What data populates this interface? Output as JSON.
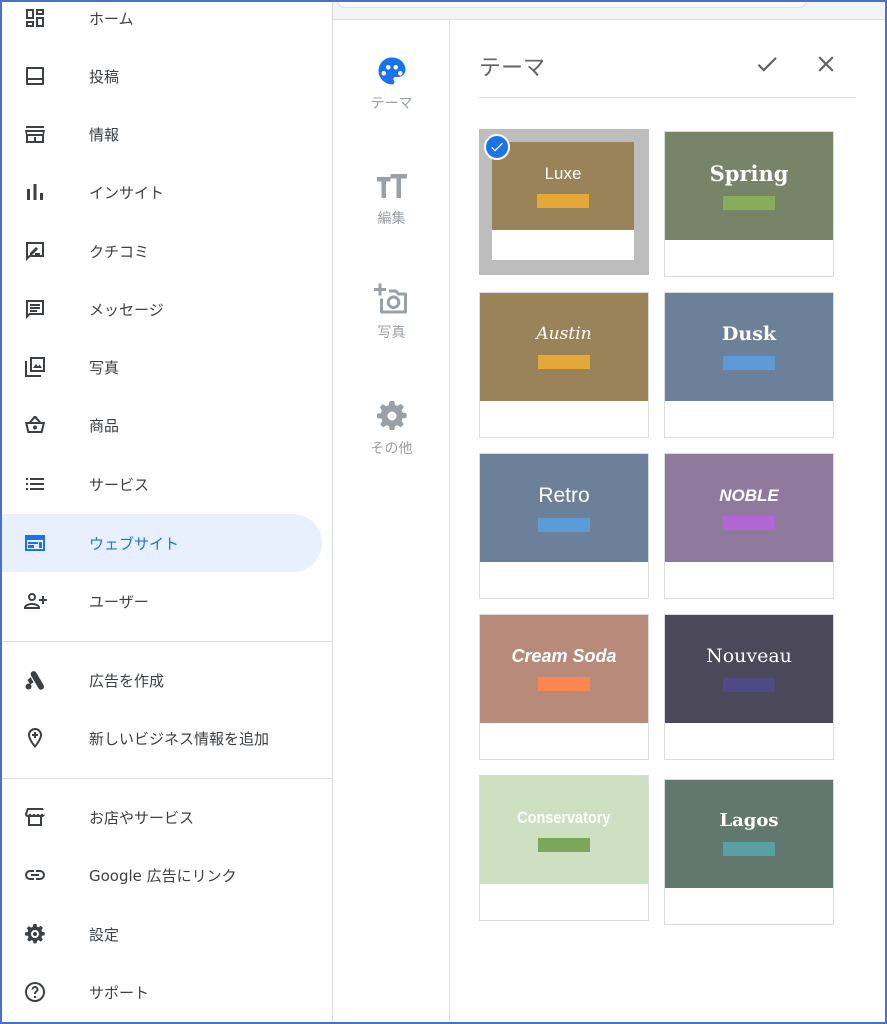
{
  "nav": {
    "items": [
      {
        "label": "ホーム",
        "icon": "dashboard-icon"
      },
      {
        "label": "投稿",
        "icon": "post-icon"
      },
      {
        "label": "情報",
        "icon": "storefront-icon"
      },
      {
        "label": "インサイト",
        "icon": "bar-chart-icon"
      },
      {
        "label": "クチコミ",
        "icon": "rate-review-icon"
      },
      {
        "label": "メッセージ",
        "icon": "message-icon"
      },
      {
        "label": "写真",
        "icon": "photo-library-icon"
      },
      {
        "label": "商品",
        "icon": "shopping-basket-icon"
      },
      {
        "label": "サービス",
        "icon": "list-icon"
      },
      {
        "label": "ウェブサイト",
        "icon": "web-icon",
        "active": true
      },
      {
        "label": "ユーザー",
        "icon": "person-add-icon"
      }
    ],
    "secondary": [
      {
        "label": "広告を作成",
        "icon": "google-ads-icon"
      },
      {
        "label": "新しいビジネス情報を追加",
        "icon": "add-location-icon"
      }
    ],
    "footer": [
      {
        "label": "お店やサービス",
        "icon": "store-icon"
      },
      {
        "label": "Google 広告にリンク",
        "icon": "link-icon"
      },
      {
        "label": "設定",
        "icon": "settings-icon"
      },
      {
        "label": "サポート",
        "icon": "help-icon"
      }
    ]
  },
  "tools": [
    {
      "label": "テーマ",
      "icon": "palette-icon",
      "active": true
    },
    {
      "label": "編集",
      "icon": "text-fields-icon"
    },
    {
      "label": "写真",
      "icon": "add-photo-icon"
    },
    {
      "label": "その他",
      "icon": "settings-icon"
    }
  ],
  "panel": {
    "title": "テーマ",
    "confirm_icon": "check-icon",
    "close_icon": "close-icon"
  },
  "themes": [
    {
      "name": "Luxe",
      "bg": "#9a8358",
      "accent": "#e4a73a",
      "selected": true
    },
    {
      "name": "Spring",
      "bg": "#788468",
      "accent": "#87ad5a"
    },
    {
      "name": "Austin",
      "bg": "#9a8358",
      "accent": "#e4a73a"
    },
    {
      "name": "Dusk",
      "bg": "#6c8199",
      "accent": "#5a9bd8"
    },
    {
      "name": "Retro",
      "bg": "#6c8199",
      "accent": "#5a9bd8"
    },
    {
      "name": "NOBLE",
      "bg": "#8f7a9e",
      "accent": "#b266d3"
    },
    {
      "name": "Cream Soda",
      "bg": "#b88a79",
      "accent": "#fb8650"
    },
    {
      "name": "Nouveau",
      "bg": "#4a4859",
      "accent": "#4f4a86"
    },
    {
      "name": "Conservatory",
      "bg": "#cde0c2",
      "accent": "#7ca75a"
    },
    {
      "name": "Lagos",
      "bg": "#62786e",
      "accent": "#58a0a3"
    }
  ]
}
